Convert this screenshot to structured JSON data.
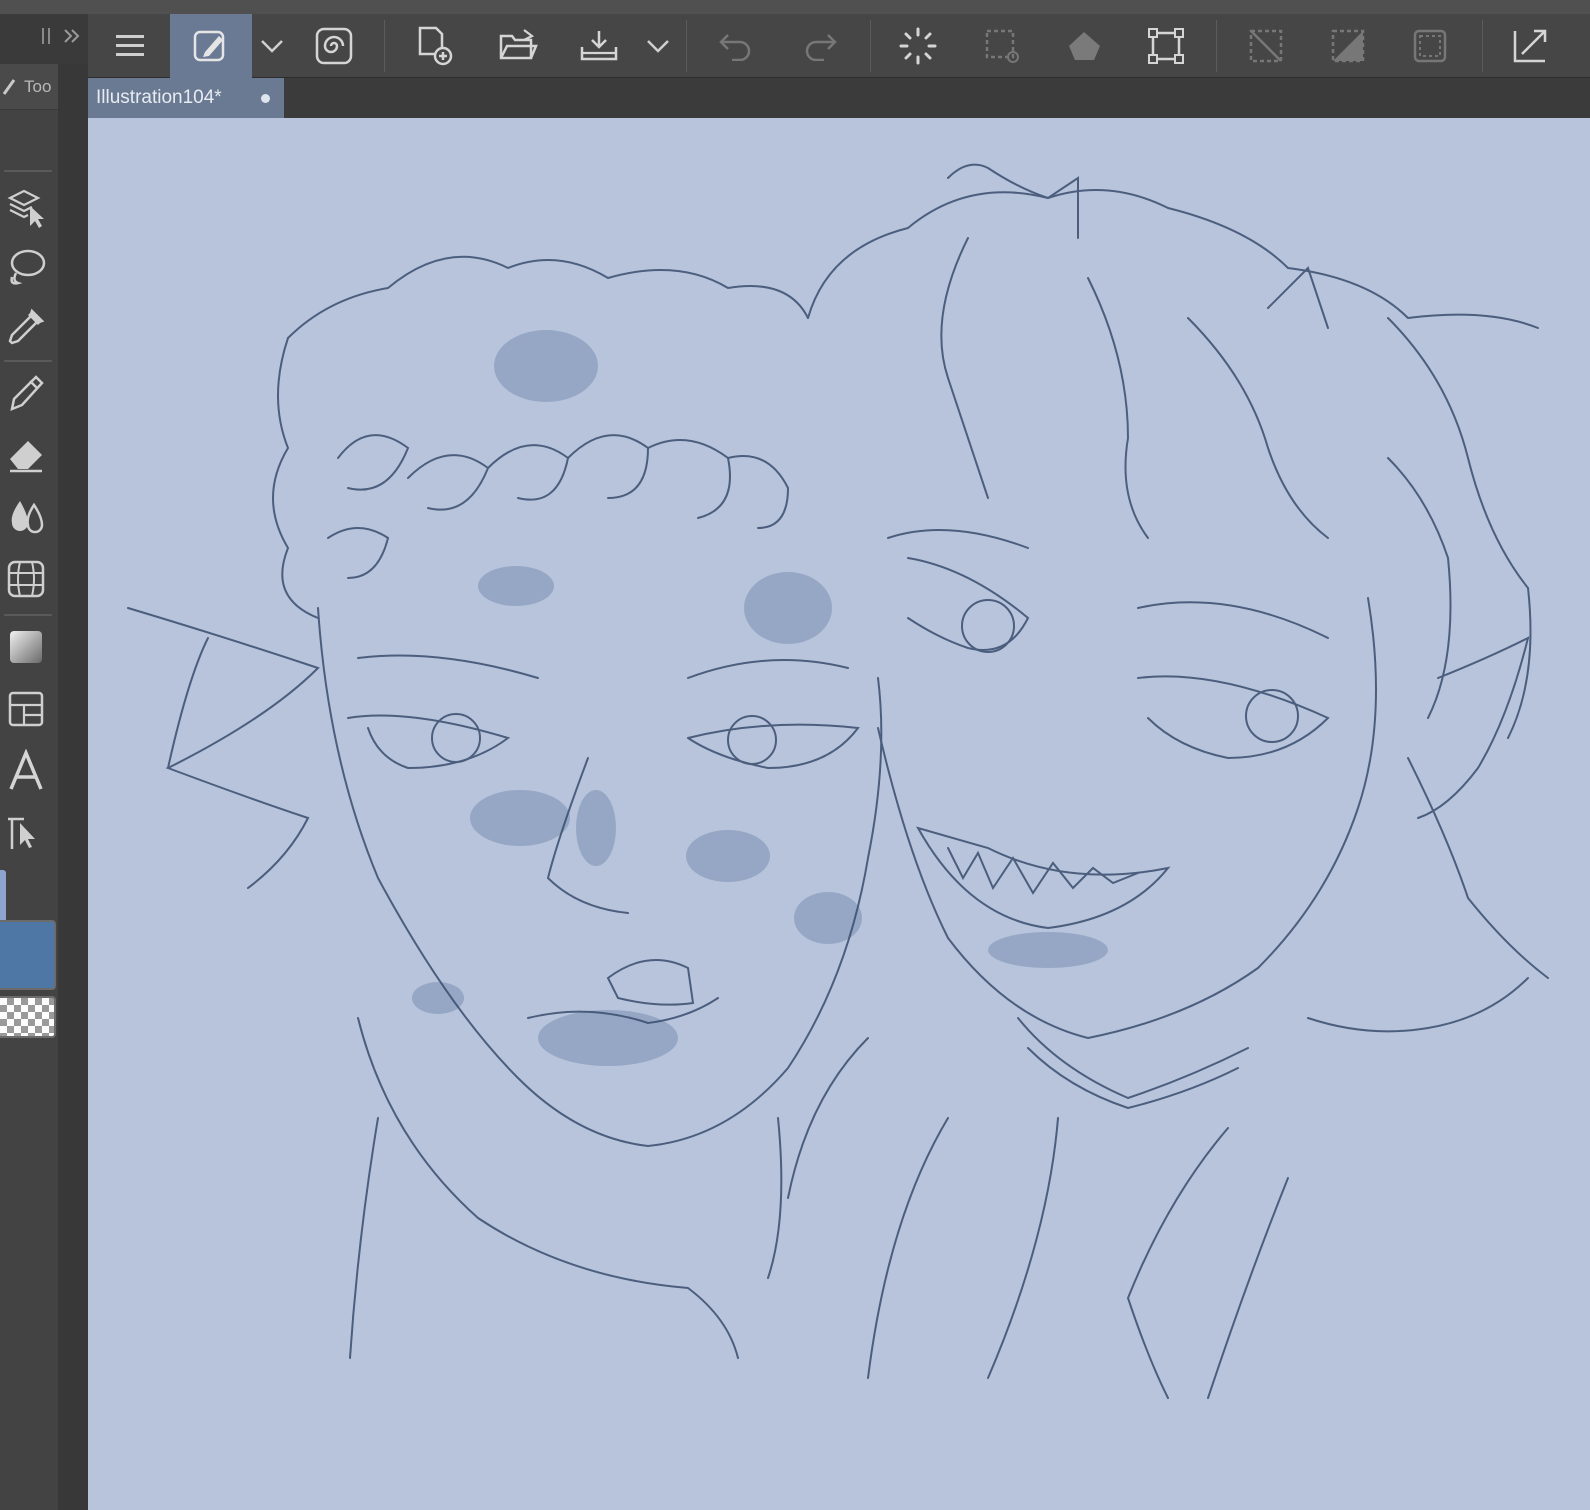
{
  "document": {
    "tab_title": "Illustration104*",
    "unsaved_indicator": "dot-icon"
  },
  "tool_palette": {
    "tab_label": "Too"
  },
  "toolbar": {
    "buttons": [
      {
        "name": "menu-icon"
      },
      {
        "name": "edit-layer-icon"
      },
      {
        "name": "chevron-down-icon"
      },
      {
        "name": "spiral-icon"
      },
      {
        "name": "new-file-icon"
      },
      {
        "name": "open-folder-icon"
      },
      {
        "name": "save-icon"
      },
      {
        "name": "chevron-down-icon"
      },
      {
        "name": "undo-icon"
      },
      {
        "name": "redo-icon"
      },
      {
        "name": "loading-spinner-icon"
      },
      {
        "name": "select-area-icon"
      },
      {
        "name": "fill-icon"
      },
      {
        "name": "transform-icon"
      },
      {
        "name": "deselect-icon"
      },
      {
        "name": "invert-selection-icon"
      },
      {
        "name": "selection-border-icon"
      },
      {
        "name": "zoom-corner-icon"
      }
    ]
  },
  "tools": [
    {
      "name": "layer-select-icon"
    },
    {
      "name": "lasso-icon"
    },
    {
      "name": "eyedropper-icon"
    },
    {
      "name": "pen-icon"
    },
    {
      "name": "eraser-icon"
    },
    {
      "name": "blend-icon"
    },
    {
      "name": "perspective-ruler-icon"
    },
    {
      "name": "gradient-icon"
    },
    {
      "name": "frame-icon"
    },
    {
      "name": "text-icon"
    },
    {
      "name": "operation-icon"
    }
  ],
  "colors": {
    "canvas_bg": "#b7c4db",
    "sketch_line": "#3a4d6e",
    "blush": "#6c85aa",
    "main_color": "#4f77a6",
    "active_tool_bg": "#6a7a95",
    "doc_tab_bg": "#6b7a93"
  }
}
